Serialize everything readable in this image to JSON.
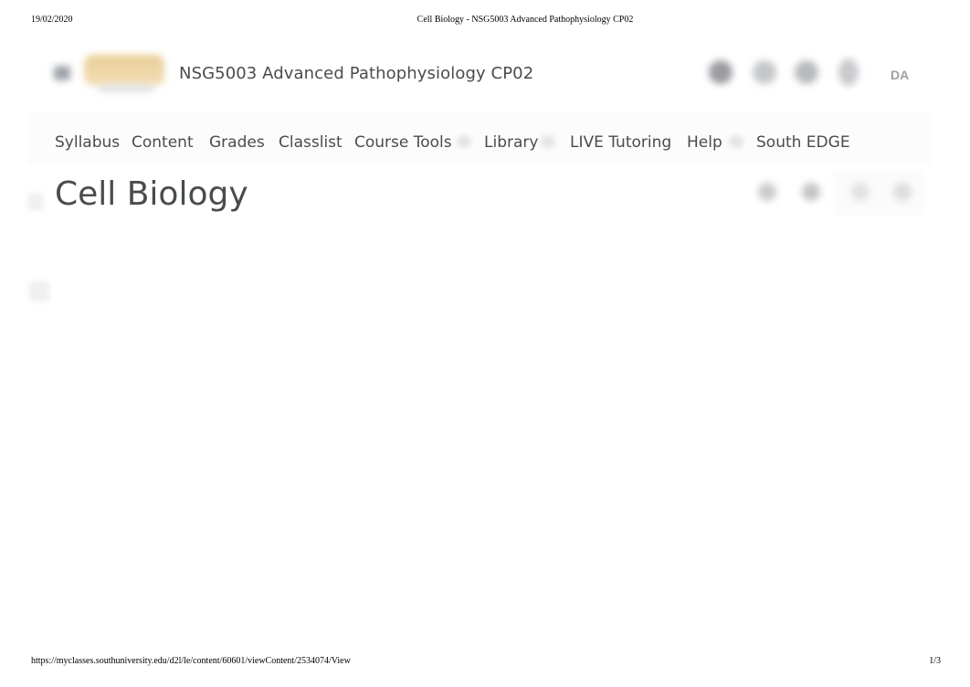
{
  "print_header": {
    "date": "19/02/2020",
    "title": "Cell Biology - NSG5003 Advanced Pathophysiology CP02"
  },
  "minibar": {
    "course_title": "NSG5003 Advanced Pathophysiology CP02",
    "icons": [
      "grid-icon",
      "message-icon",
      "chat-icon",
      "bell-icon"
    ],
    "user_initials": "DA"
  },
  "navbar": {
    "items": [
      {
        "label": "Syllabus",
        "has_dropdown": false
      },
      {
        "label": "Content",
        "has_dropdown": false
      },
      {
        "label": "Grades",
        "has_dropdown": false
      },
      {
        "label": "Classlist",
        "has_dropdown": false
      },
      {
        "label": "Course Tools",
        "has_dropdown": true
      },
      {
        "label": "Library",
        "has_dropdown": true
      },
      {
        "label": "LIVE Tutoring",
        "has_dropdown": false
      },
      {
        "label": "Help",
        "has_dropdown": true
      },
      {
        "label": "South EDGE",
        "has_dropdown": false
      }
    ]
  },
  "content": {
    "title": "Cell Biology",
    "tool_icons": [
      "print-icon",
      "download-icon",
      "previous-icon",
      "next-icon"
    ]
  },
  "print_footer": {
    "url": "https://myclasses.southuniversity.edu/d2l/le/content/60601/viewContent/2534074/View",
    "page": "1/3"
  }
}
